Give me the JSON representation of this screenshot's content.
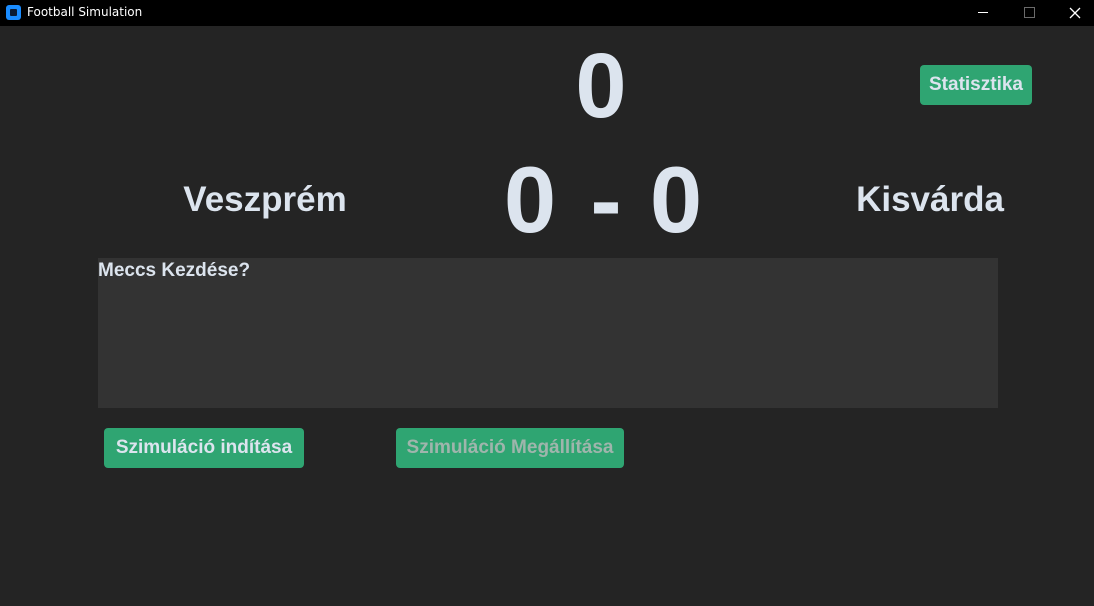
{
  "window": {
    "title": "Football Simulation"
  },
  "match": {
    "timer": "0",
    "home_team": "Veszprém",
    "away_team": "Kisvárda",
    "home_score": "0",
    "separator": "-",
    "away_score": "0"
  },
  "commentary": {
    "text": "Meccs Kezdése?"
  },
  "buttons": {
    "stats_label": "Statisztika",
    "start_label": "Szimuláció indítása",
    "stop_label": "Szimuláció Megállítása"
  },
  "colors": {
    "background": "#242424",
    "panel": "#333333",
    "accent": "#2fa572",
    "text": "#dce4ee",
    "disabled_text": "#9fb5ac",
    "titlebar": "#000000"
  },
  "icons": {
    "app": "app-icon",
    "minimize": "minimize-icon",
    "maximize": "maximize-icon",
    "close": "close-icon"
  }
}
